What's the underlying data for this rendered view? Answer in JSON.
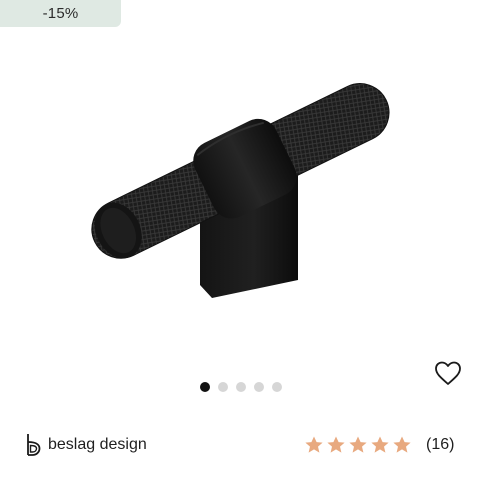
{
  "badge": {
    "text": "-15%"
  },
  "product": {
    "image_icon": "t-bar-knurled-handle-image",
    "colors": {
      "metal": "#1a1a1a"
    }
  },
  "carousel": {
    "count": 5,
    "active_index": 0
  },
  "favorite": {
    "icon": "heart-outline-icon"
  },
  "brand": {
    "name": "beslag design",
    "icon": "beslag-design-logo"
  },
  "rating": {
    "stars": 5,
    "max": 5,
    "count_label": "(16)",
    "star_color": "#e8a97f"
  },
  "colors": {
    "badge_bg": "#dfe9e3",
    "dot_active": "#111111",
    "dot_inactive": "#d6d6d6"
  }
}
